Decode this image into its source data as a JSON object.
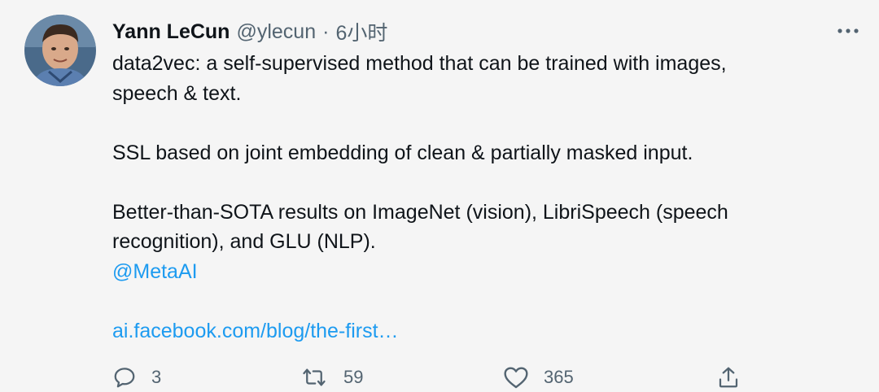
{
  "author": {
    "name": "Yann LeCun",
    "handle": "@ylecun",
    "separator": "·",
    "time": "6小时"
  },
  "tweet": {
    "line1": "data2vec: a self-supervised method that can be trained with images,",
    "line2": "speech & text.",
    "line3": "SSL based on joint embedding of clean & partially masked input.",
    "line4": "Better-than-SOTA results on ImageNet (vision), LibriSpeech (speech",
    "line5": "recognition), and GLU (NLP).",
    "mention": "@MetaAI",
    "link": "ai.facebook.com/blog/the-first…"
  },
  "actions": {
    "reply_count": "3",
    "retweet_count": "59",
    "like_count": "365"
  },
  "icons": {
    "more": "more-horizontal-icon",
    "reply": "reply-icon",
    "retweet": "retweet-icon",
    "like": "heart-icon",
    "share": "share-icon"
  },
  "colors": {
    "background": "#f5f5f5",
    "text": "#0f1419",
    "secondary": "#536471",
    "link": "#1d9bf0"
  }
}
